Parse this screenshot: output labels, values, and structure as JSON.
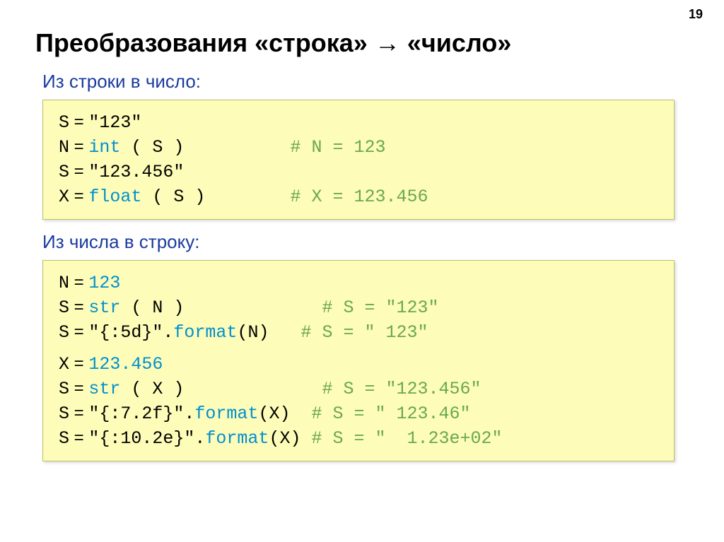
{
  "page_number": "19",
  "title_pre": "Преобразования «строка» ",
  "title_post": " «число»",
  "subtitle1": "Из строки в число:",
  "subtitle2": "Из числа в строку:",
  "block1": {
    "l1_lhs": "S",
    "l1_rhs": "\"123\"",
    "l2_lhs": "N",
    "l2_kw": "int",
    "l2_arg": " ( S )",
    "l2_cmt": "# N = 123",
    "l3_lhs": "S",
    "l3_rhs": "\"123.456\"",
    "l4_lhs": "X",
    "l4_kw": "float",
    "l4_arg": " ( S )",
    "l4_cmt": "# X = 123.456"
  },
  "block2": {
    "l1_lhs": "N",
    "l1_num": "123",
    "l2_lhs": "S",
    "l2_kw": "str",
    "l2_arg": " ( N )",
    "l2_cmt": "# S = \"123\"",
    "l3_lhs": "S",
    "l3_str": "\"{:5d}\"",
    "l3_kw": "format",
    "l3_arg": "(N)",
    "l3_cmt": "# S = \" 123\"",
    "l4_lhs": "X",
    "l4_num": "123.456",
    "l5_lhs": "S",
    "l5_kw": "str",
    "l5_arg": " ( X )",
    "l5_cmt": "# S = \"123.456\"",
    "l6_lhs": "S",
    "l6_str": "\"{:7.2f}\"",
    "l6_kw": "format",
    "l6_arg": "(X)",
    "l6_cmt": "# S = \" 123.46\"",
    "l7_lhs": "S",
    "l7_str": "\"{:10.2e}\"",
    "l7_kw": "format",
    "l7_arg": "(X)",
    "l7_cmt": "# S = \"  1.23e+02\""
  }
}
